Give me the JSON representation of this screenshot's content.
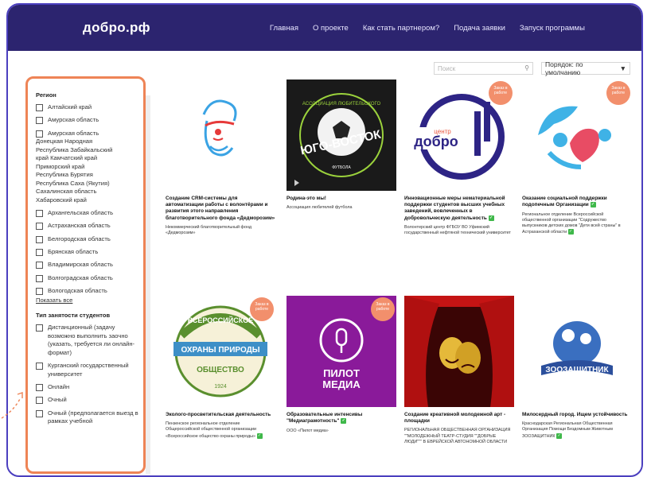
{
  "header": {
    "logo": "добро.рф",
    "nav": [
      "Главная",
      "О проекте",
      "Как стать партнером?",
      "Подача заявки",
      "Запуск программы"
    ]
  },
  "toolbar": {
    "search_placeholder": "Поиск",
    "sort_label": "Порядок: по умолчанию"
  },
  "sidebar": {
    "region_title": "Регион",
    "region_items_top": [
      "Алтайский край",
      "Амурская область",
      "Амурская область"
    ],
    "region_plain": [
      "Донецкая Народная",
      "Республика Забайкальский",
      "край Камчатский край",
      "Приморский край",
      "Республика Бурятия",
      "Республика Саха (Якутия)",
      "Сахалинская область",
      "Хабаровский край"
    ],
    "region_items_bottom": [
      "Архангельская область",
      "Астраханская область",
      "Белгородская область",
      "Брянская область",
      "Владимирская область",
      "Волгоградская область",
      "Вологодская область"
    ],
    "show_all": "Показать все",
    "employment_title": "Тип занятости студентов",
    "employment_items": [
      "Дистанционный (задачу возможно выполнить заочно (указать, требуется ли онлайн-формат)",
      "Курганский государственный университет",
      "Онлайн",
      "Очный",
      "Очный (предполагается выезд в рамках учебной"
    ]
  },
  "cards": [
    {
      "title": "Создание CRM-системы для автоматизации работы с волонтёрами и развития этого направления благотворительного фонда «Дедморозим»",
      "org": "Некоммерческий благотворительный фонд «Дедморозим»",
      "badge": ""
    },
    {
      "title": "Родина-это мы!",
      "org": "Ассоциация любителей футбола",
      "badge": ""
    },
    {
      "title": "Инновационные меры нематериальной поддержки студентов высших учебных заведений, вовлеченных в добровольческую деятельность",
      "org": "Волонтерский центр ФГБОУ ВО Уфимский государственный нефтяной технический университет",
      "badge": "Заказ в работе"
    },
    {
      "title": "Оказание социальной поддержки подопечным Организации",
      "org": "Региональное отделение Всероссийской общественной организации \"Содружество выпускников детских домов \"Дети всей страны\" в Астраханской области",
      "badge": "Заказ в работе"
    },
    {
      "title": "Эколого-просветительская деятельность",
      "org": "Пензенское региональное отделение Общероссийской общественной организации «Всероссийское общество охраны природы»",
      "badge": "Заказ в работе"
    },
    {
      "title": "Образовательные интенсивы \"Медиаграмотность\"",
      "org": "ООО «Пилот медиа»",
      "badge": "Заказ в работе"
    },
    {
      "title": "Создание креативной молодежной арт - площадки",
      "org": "РЕГИОНАЛЬНАЯ ОБЩЕСТВЕННАЯ ОРГАНИЗАЦИЯ \"\"МОЛОДЕЖНЫЙ ТЕАТР-СТУДИЯ \"\"ДОБРЫЕ ЛЮДИ\"\"\" В ЕВРЕЙСКОЙ АВТОНОМНОЙ ОБЛАСТИ",
      "badge": ""
    },
    {
      "title": "Милосердный город. Ищем устойчивость",
      "org": "Краснодарская Региональная Общественная Организация Помощи Бездомным Животным ЗООЗАЩИТНИК",
      "badge": ""
    }
  ],
  "images": {
    "football": {
      "line1": "АССОЦИАЦИЯ ЛЮБИТЕЛЬСКОГО",
      "main": "ЮГО-ВОСТОК",
      "sub": "ФУТБОЛА"
    },
    "dobro": {
      "small": "центр",
      "main": "добро"
    },
    "nature": {
      "top": "ВСЕРОССИЙСКОЕ",
      "mid": "ОХРАНЫ ПРИРОДЫ",
      "bottom": "ОБЩЕСТВО",
      "year": "1924"
    },
    "pilot": {
      "line1": "ПИЛОТ",
      "line2": "МЕДИА"
    },
    "zoo": {
      "label": "ЗООЗАЩИТНИК"
    }
  },
  "colors": {
    "header": "#2c246f",
    "accent_orange": "#ee8456",
    "badge": "#f28f6c",
    "frame": "#4b3fbf"
  }
}
